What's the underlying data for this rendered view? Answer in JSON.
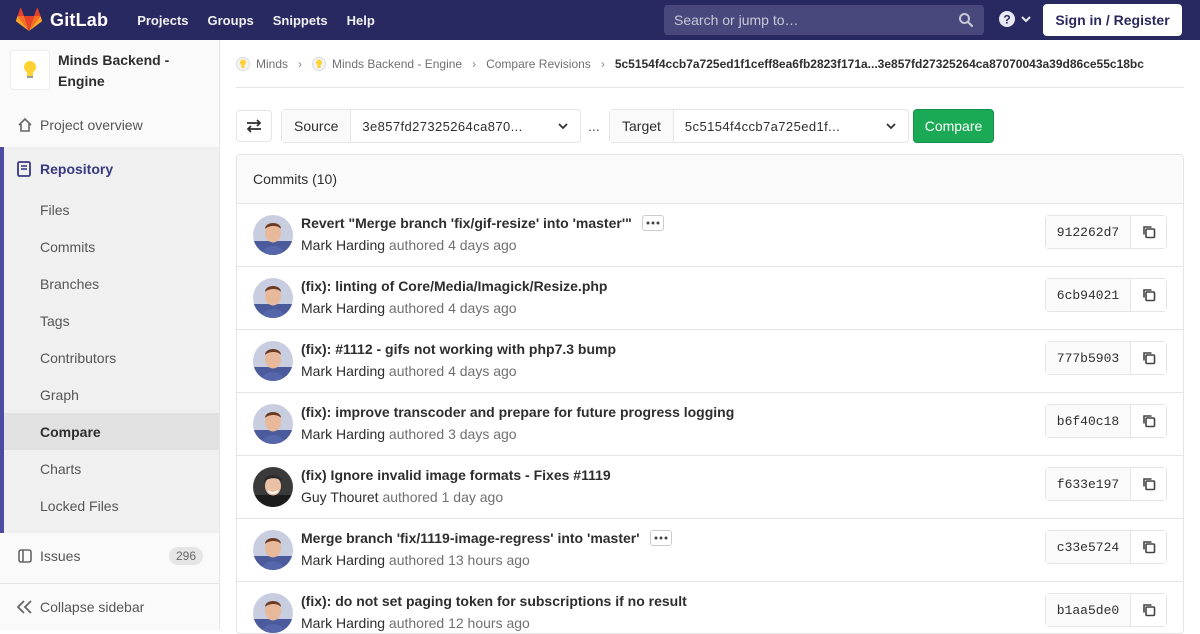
{
  "navbar": {
    "brand": "GitLab",
    "links": [
      "Projects",
      "Groups",
      "Snippets",
      "Help"
    ],
    "search_placeholder": "Search or jump to…",
    "signin": "Sign in / Register"
  },
  "sidebar": {
    "project_name": "Minds Backend - Engine",
    "overview": "Project overview",
    "repository": "Repository",
    "repo_items": [
      "Files",
      "Commits",
      "Branches",
      "Tags",
      "Contributors",
      "Graph",
      "Compare",
      "Charts",
      "Locked Files"
    ],
    "active_item": "Compare",
    "issues": "Issues",
    "issues_count": "296",
    "collapse": "Collapse sidebar"
  },
  "breadcrumb": {
    "items": [
      "Minds",
      "Minds Backend - Engine",
      "Compare Revisions"
    ],
    "current": "5c5154f4ccb7a725ed1f1ceff8ea6fb2823f171a...3e857fd27325264ca87070043a39d86ce55c18bc"
  },
  "compare": {
    "source_label": "Source",
    "source_value": "3e857fd27325264ca870...",
    "separator": "...",
    "target_label": "Target",
    "target_value": "5c5154f4ccb7a725ed1f...",
    "button": "Compare"
  },
  "commits": {
    "header": "Commits (10)",
    "authored_word": "authored",
    "items": [
      {
        "title": "Revert \"Merge branch 'fix/gif-resize' into 'master'\"",
        "author": "Mark Harding",
        "time": "4 days ago",
        "sha": "912262d7",
        "more": true,
        "avatar": "mark"
      },
      {
        "title": "(fix): linting of Core/Media/Imagick/Resize.php",
        "author": "Mark Harding",
        "time": "4 days ago",
        "sha": "6cb94021",
        "more": false,
        "avatar": "mark"
      },
      {
        "title": "(fix): #1112 - gifs not working with php7.3 bump",
        "author": "Mark Harding",
        "time": "4 days ago",
        "sha": "777b5903",
        "more": false,
        "avatar": "mark"
      },
      {
        "title": "(fix): improve transcoder and prepare for future progress logging",
        "author": "Mark Harding",
        "time": "3 days ago",
        "sha": "b6f40c18",
        "more": false,
        "avatar": "mark"
      },
      {
        "title": "(fix) Ignore invalid image formats - Fixes #1119",
        "author": "Guy Thouret",
        "time": "1 day ago",
        "sha": "f633e197",
        "more": false,
        "avatar": "guy"
      },
      {
        "title": "Merge branch 'fix/1119-image-regress' into 'master'",
        "author": "Mark Harding",
        "time": "13 hours ago",
        "sha": "c33e5724",
        "more": true,
        "avatar": "mark"
      },
      {
        "title": "(fix): do not set paging token for subscriptions if no result",
        "author": "Mark Harding",
        "time": "12 hours ago",
        "sha": "b1aa5de0",
        "more": false,
        "avatar": "mark"
      }
    ]
  }
}
